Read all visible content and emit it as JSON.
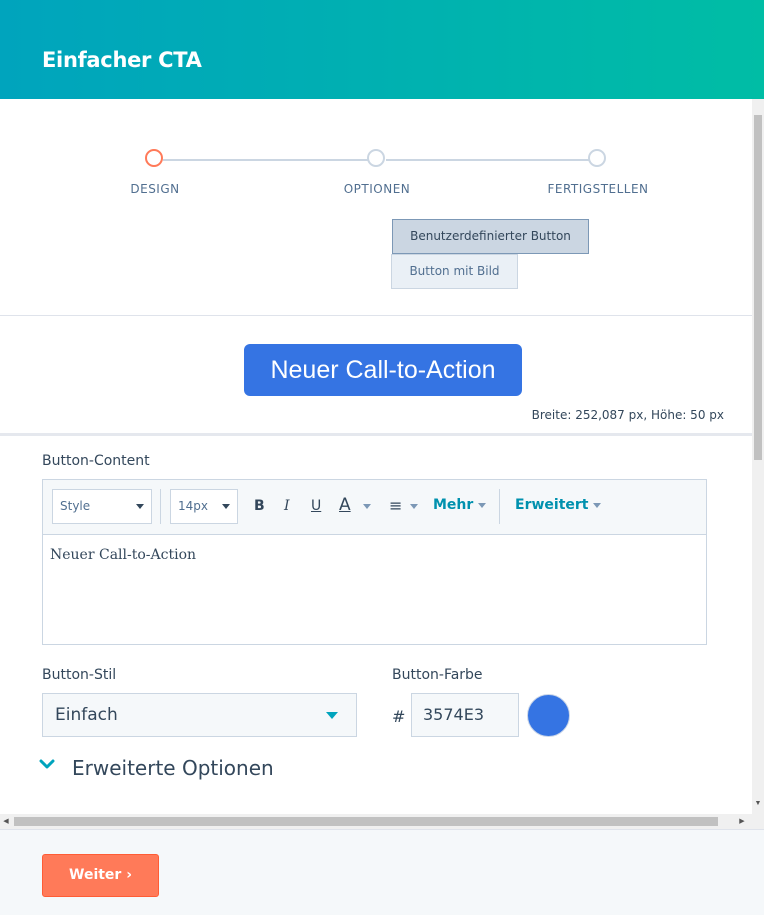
{
  "header": {
    "title": "Einfacher CTA"
  },
  "steps": [
    {
      "label": "DESIGN",
      "state": "active"
    },
    {
      "label": "OPTIONEN",
      "state": "inactive"
    },
    {
      "label": "FERTIGSTELLEN",
      "state": "inactive"
    }
  ],
  "type_options": {
    "custom_button": "Benutzerdefinierter Button",
    "image_button": "Button mit Bild"
  },
  "preview": {
    "cta_text": "Neuer Call-to-Action",
    "dimensions": "Breite: 252,087 px, Höhe: 50 px"
  },
  "content": {
    "label": "Button-Content",
    "toolbar": {
      "style": "Style",
      "font_size": "14px",
      "bold": "B",
      "italic": "I",
      "underline": "U",
      "text_color": "A",
      "align": "≡",
      "more": "Mehr",
      "advanced": "Erweitert"
    },
    "text": "Neuer Call-to-Action"
  },
  "button_style": {
    "label": "Button-Stil",
    "value": "Einfach"
  },
  "button_color": {
    "label": "Button-Farbe",
    "hash": "#",
    "value": "3574E3",
    "swatch": "#3574E3"
  },
  "advanced_options": {
    "label": "Erweiterte Optionen"
  },
  "footer": {
    "next_label": "Weiter"
  },
  "colors": {
    "accent": "#00a4bd",
    "cta": "#3574E3",
    "next": "#ff7a59",
    "active_step": "#ff7a59"
  }
}
